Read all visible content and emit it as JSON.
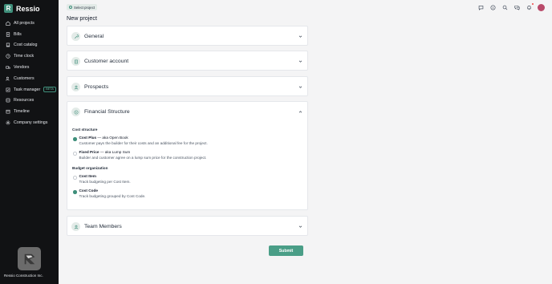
{
  "brand": {
    "name": "Ressio",
    "logo_letter": "R"
  },
  "nav": [
    {
      "label": "All projects",
      "icon": "home-icon"
    },
    {
      "label": "Bills",
      "icon": "file-icon"
    },
    {
      "label": "Cost catalog",
      "icon": "book-icon"
    },
    {
      "label": "Time clock",
      "icon": "clock-icon"
    },
    {
      "label": "Vendors",
      "icon": "truck-icon"
    },
    {
      "label": "Customers",
      "icon": "users-icon"
    },
    {
      "label": "Task manager",
      "icon": "tasks-icon",
      "badge": "BETA"
    },
    {
      "label": "Resources",
      "icon": "layers-icon"
    },
    {
      "label": "Timeline",
      "icon": "calendar-icon"
    },
    {
      "label": "Company settings",
      "icon": "gear-icon"
    }
  ],
  "company": {
    "name": "Ressio Construction Inc."
  },
  "topbar": {
    "project_select": "Select project"
  },
  "page": {
    "title": "New project"
  },
  "sections": {
    "general": "General",
    "customer_account": "Customer account",
    "prospects": "Prospects",
    "financial": "Financial Structure",
    "team": "Team Members"
  },
  "financial": {
    "cost_structure_label": "Cost structure",
    "cost_plus_title": "Cost Plus",
    "cost_plus_aka": " — aka Open Book",
    "cost_plus_desc": "Customer pays the builder for their costs and an additional fee for the project.",
    "fixed_price_title": "Fixed Price",
    "fixed_price_aka": " — aka Lump Sum",
    "fixed_price_desc": "Builder and customer agree on a lump sum price for the construction project.",
    "budget_org_label": "Budget organization",
    "cost_item_title": "Cost Item",
    "cost_item_desc": "Track budgeting per Cost Item.",
    "cost_code_title": "Cost Code",
    "cost_code_desc": "Track budgeting grouped by Cost Code.",
    "selected_structure": "Cost Plus",
    "selected_budget": "Cost Code"
  },
  "actions": {
    "submit": "Submit"
  },
  "colors": {
    "accent": "#3f8f7b",
    "sidebar": "#111214",
    "background": "#f4f4f5"
  }
}
